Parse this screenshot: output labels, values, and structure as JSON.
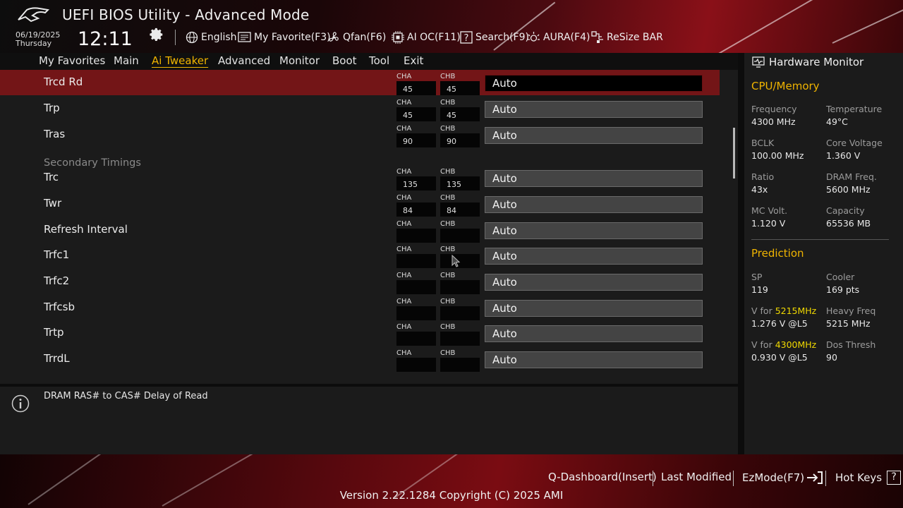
{
  "header": {
    "title": "UEFI BIOS Utility - Advanced Mode",
    "date": "06/19/2025",
    "day": "Thursday",
    "time": "12:11",
    "tools": {
      "language": "English",
      "favorite": "My Favorite(F3)",
      "qfan": "Qfan(F6)",
      "aioc": "AI OC(F11)",
      "search": "Search(F9)",
      "aura": "AURA(F4)",
      "resizebar": "ReSize BAR"
    }
  },
  "nav": {
    "tabs": [
      "My Favorites",
      "Main",
      "Ai Tweaker",
      "Advanced",
      "Monitor",
      "Boot",
      "Tool",
      "Exit"
    ],
    "active": "Ai Tweaker"
  },
  "channel_labels": {
    "a": "CHA",
    "b": "CHB"
  },
  "settings": [
    {
      "label": "Trcd Rd",
      "cha": "45",
      "chb": "45",
      "value": "Auto",
      "selected": true
    },
    {
      "label": "Trp",
      "cha": "45",
      "chb": "45",
      "value": "Auto"
    },
    {
      "label": "Tras",
      "cha": "90",
      "chb": "90",
      "value": "Auto"
    },
    {
      "label": "Trc",
      "cha": "135",
      "chb": "135",
      "value": "Auto"
    },
    {
      "label": "Twr",
      "cha": "84",
      "chb": "84",
      "value": "Auto"
    },
    {
      "label": "Refresh Interval",
      "cha": "",
      "chb": "",
      "value": "Auto"
    },
    {
      "label": "Trfc1",
      "cha": "",
      "chb": "",
      "value": "Auto"
    },
    {
      "label": "Trfc2",
      "cha": "",
      "chb": "",
      "value": "Auto"
    },
    {
      "label": "Trfcsb",
      "cha": "",
      "chb": "",
      "value": "Auto"
    },
    {
      "label": "Trtp",
      "cha": "",
      "chb": "",
      "value": "Auto"
    },
    {
      "label": "TrrdL",
      "cha": "",
      "chb": "",
      "value": "Auto"
    }
  ],
  "section_label": "Secondary Timings",
  "help_text": "DRAM RAS# to CAS# Delay of Read",
  "hardware_monitor": {
    "title": "Hardware Monitor",
    "cpu_memory": {
      "heading": "CPU/Memory",
      "items": [
        {
          "label": "Frequency",
          "value": "4300 MHz"
        },
        {
          "label": "Temperature",
          "value": "49°C"
        },
        {
          "label": "BCLK",
          "value": "100.00 MHz"
        },
        {
          "label": "Core Voltage",
          "value": "1.360 V"
        },
        {
          "label": "Ratio",
          "value": "43x"
        },
        {
          "label": "DRAM Freq.",
          "value": "5600 MHz"
        },
        {
          "label": "MC Volt.",
          "value": "1.120 V"
        },
        {
          "label": "Capacity",
          "value": "65536 MB"
        }
      ]
    },
    "prediction": {
      "heading": "Prediction",
      "sp_label": "SP",
      "sp_value": "119",
      "cooler_label": "Cooler",
      "cooler_value": "169 pts",
      "v1_prefix": "V for ",
      "v1_freq": "5215MHz",
      "v1_value": "1.276 V @L5",
      "heavy_label": "Heavy Freq",
      "heavy_value": "5215 MHz",
      "v2_prefix": "V for ",
      "v2_freq": "4300MHz",
      "v2_value": "0.930 V @L5",
      "dos_label": "Dos Thresh",
      "dos_value": "90"
    }
  },
  "footer": {
    "qdashboard": "Q-Dashboard(Insert)",
    "last_modified": "Last Modified",
    "ezmode": "EzMode(F7)",
    "hotkeys": "Hot Keys",
    "hotkeys_badge": "?",
    "version": "Version 2.22.1284 Copyright (C) 2025 AMI"
  },
  "colors": {
    "accent": "#f0b400",
    "selected_row": "#731517",
    "highlight": "#f0d800",
    "panel": "#1b1b1b"
  }
}
